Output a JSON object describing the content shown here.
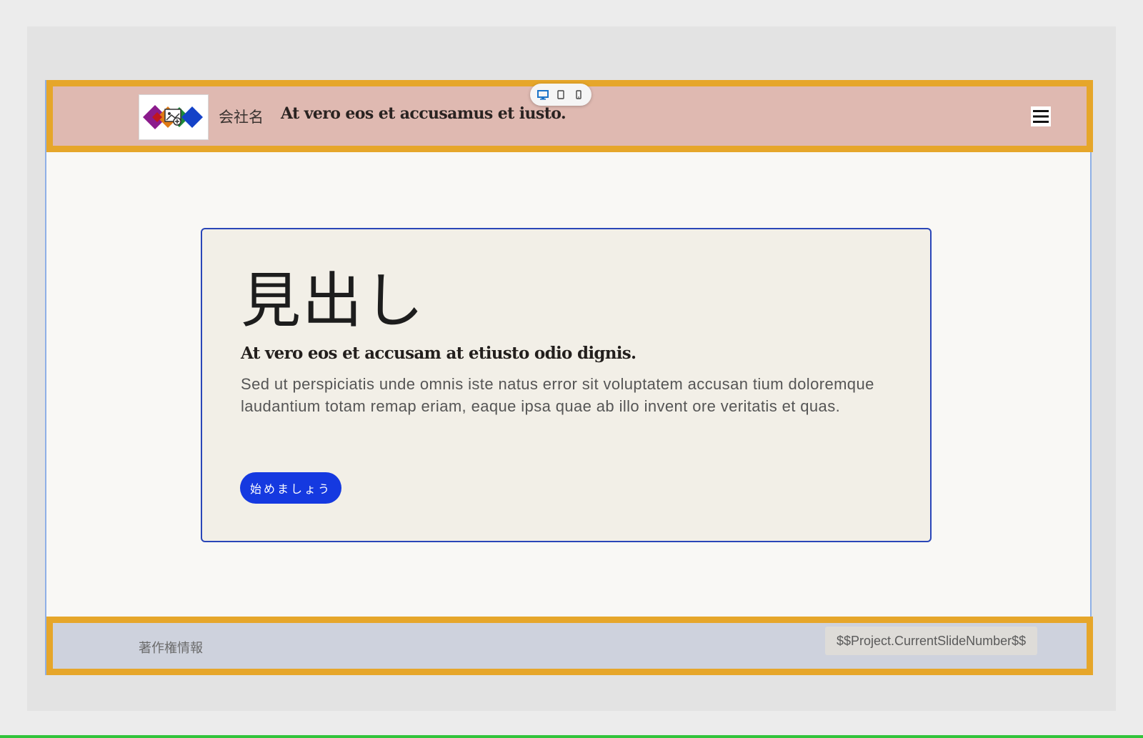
{
  "header": {
    "company_name": "会社名",
    "tagline": "At vero eos et accusamus et iusto."
  },
  "device_toggle": {
    "items": [
      {
        "icon": "desktop-icon",
        "active": true
      },
      {
        "icon": "tablet-icon",
        "active": false
      },
      {
        "icon": "mobile-icon",
        "active": false
      }
    ]
  },
  "hero": {
    "heading": "見出し",
    "subheading": "At vero eos et accusam at etiusto odio dignis.",
    "body": "Sed ut perspiciatis unde omnis iste natus error sit voluptatem accusan tium doloremque laudantium totam remap eriam, eaque ipsa quae ab illo invent ore veritatis et quas.",
    "cta_label": "始めましょう"
  },
  "footer": {
    "copyright": "著作権情報",
    "slide_number": "$$Project.CurrentSlideNumber$$"
  },
  "colors": {
    "header_bg": "#dfb9b1",
    "footer_bg": "#ced2dd",
    "frame_border": "#e6a62a",
    "card_border": "#2a46b8",
    "cta_bg": "#1539e0",
    "active_device": "#1a73c8"
  }
}
